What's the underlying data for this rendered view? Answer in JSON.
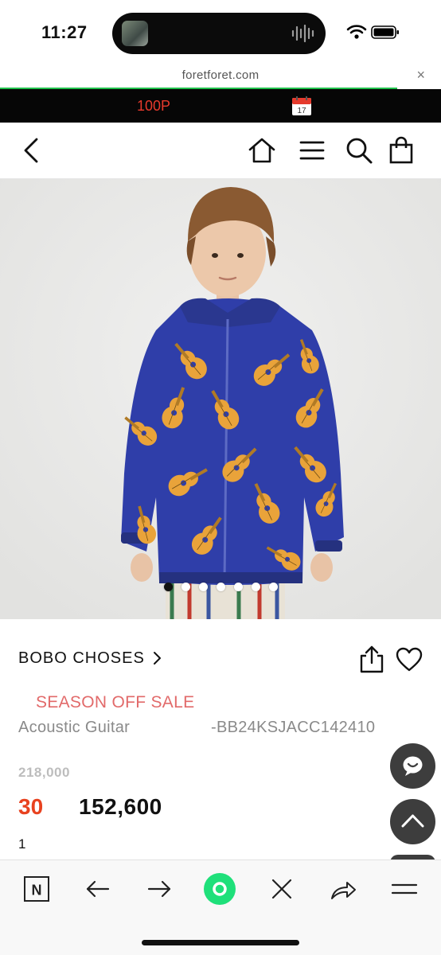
{
  "status_bar": {
    "time": "11:27"
  },
  "browser": {
    "url": "foretforet.com",
    "close_glyph": "×",
    "load_progress": 0.9
  },
  "promo": {
    "points": "100P",
    "calendar_day": "17"
  },
  "header": {
    "icons": [
      "back-arrow-icon",
      "home-icon",
      "menu-icon",
      "search-icon",
      "shopping-bag-icon"
    ]
  },
  "gallery": {
    "image_count": 7,
    "active_index": 0
  },
  "product": {
    "brand": "BOBO CHOSES",
    "sale_label": "SEASON OFF SALE",
    "name": "Acoustic Guitar",
    "code": "-BB24KSJACC142410",
    "original_price": "218,000",
    "discount": "30",
    "price": "152,600",
    "qty": "1"
  },
  "floating_buttons": [
    "chat-icon",
    "scroll-top-icon"
  ],
  "bottom_nav": [
    "naver-icon",
    "back-icon",
    "forward-icon",
    "green-circle-icon",
    "close-icon",
    "share-icon",
    "menu-icon"
  ],
  "colors": {
    "accent_green": "#1fc14b",
    "promo_red": "#e83a2c",
    "sale_pink": "#e26a6a",
    "discount_orange": "#e8421f",
    "jacket_blue": "#2f3ea9",
    "guitar_yellow": "#e9a33a"
  }
}
